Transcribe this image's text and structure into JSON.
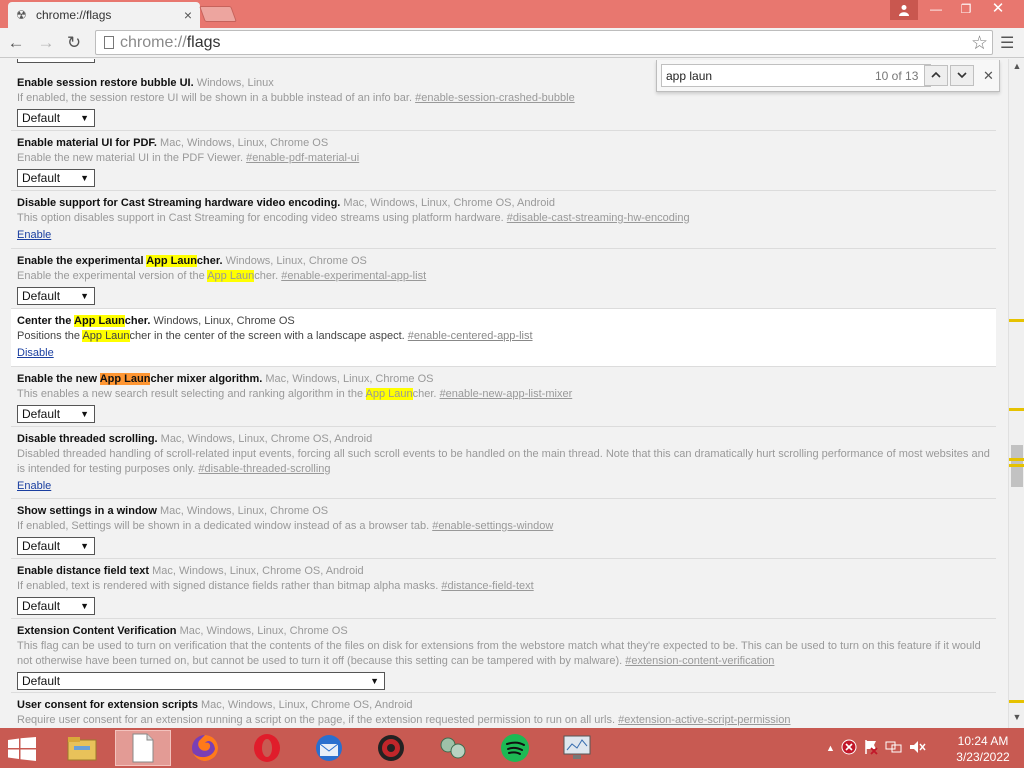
{
  "window": {
    "tab_title": "chrome://flags",
    "tab_close": "×",
    "user_icon": "person-icon",
    "min_label": "—",
    "max_label": "❐",
    "close_label": "✕"
  },
  "toolbar": {
    "url_scheme": "chrome://",
    "url_path": "flags"
  },
  "find": {
    "query": "app laun",
    "count": "10 of 13"
  },
  "flags": [
    {
      "title": "Enable session restore bubble UI.",
      "platforms": "Windows, Linux",
      "desc": "If enabled, the session restore UI will be shown in a bubble instead of an info bar.",
      "link": "#enable-session-crashed-bubble",
      "control": "Default"
    },
    {
      "title": "Enable material UI for PDF.",
      "platforms": "Mac, Windows, Linux, Chrome OS",
      "desc": "Enable the new material UI in the PDF Viewer.",
      "link": "#enable-pdf-material-ui",
      "control": "Default"
    },
    {
      "title": "Disable support for Cast Streaming hardware video encoding.",
      "platforms": "Mac, Windows, Linux, Chrome OS, Android",
      "desc": "This option disables support in Cast Streaming for encoding video streams using platform hardware.",
      "link": "#disable-cast-streaming-hw-encoding",
      "control": "Enable"
    },
    {
      "title_pre": "Enable the experimental ",
      "title_hl": "App Laun",
      "title_post": "cher.",
      "platforms": "Windows, Linux, Chrome OS",
      "desc_pre": "Enable the experimental version of the ",
      "desc_hl": "App Laun",
      "desc_post": "cher.",
      "link": "#enable-experimental-app-list",
      "control": "Default"
    },
    {
      "title_pre": "Center the ",
      "title_hl": "App Laun",
      "title_post": "cher.",
      "platforms": "Windows, Linux, Chrome OS",
      "desc_pre": "Positions the ",
      "desc_hl": "App Laun",
      "desc_post": "cher in the center of the screen with a landscape aspect.",
      "link": "#enable-centered-app-list",
      "control": "Disable"
    },
    {
      "title_pre": "Enable the new ",
      "title_hl": "App Laun",
      "title_post": "cher mixer algorithm.",
      "platforms": "Mac, Windows, Linux, Chrome OS",
      "desc_pre": "This enables a new search result selecting and ranking algorithm in the ",
      "desc_hl": "App Laun",
      "desc_post": "cher.",
      "link": "#enable-new-app-list-mixer",
      "control": "Default"
    },
    {
      "title": "Disable threaded scrolling.",
      "platforms": "Mac, Windows, Linux, Chrome OS, Android",
      "desc": "Disabled threaded handling of scroll-related input events, forcing all such scroll events to be handled on the main thread. Note that this can dramatically hurt scrolling performance of most websites and is intended for testing purposes only.",
      "link": "#disable-threaded-scrolling",
      "control": "Enable"
    },
    {
      "title": "Show settings in a window",
      "platforms": "Mac, Windows, Linux, Chrome OS",
      "desc": "If enabled, Settings will be shown in a dedicated window instead of as a browser tab.",
      "link": "#enable-settings-window",
      "control": "Default"
    },
    {
      "title": "Enable distance field text",
      "platforms": "Mac, Windows, Linux, Chrome OS, Android",
      "desc": "If enabled, text is rendered with signed distance fields rather than bitmap alpha masks.",
      "link": "#distance-field-text",
      "control": "Default"
    },
    {
      "title": "Extension Content Verification",
      "platforms": "Mac, Windows, Linux, Chrome OS",
      "desc": "This flag can be used to turn on verification that the contents of the files on disk for extensions from the webstore match what they're expected to be. This can be used to turn on this feature if it would not otherwise have been turned on, but cannot be used to turn it off (because this setting can be tampered with by malware).",
      "link": "#extension-content-verification",
      "control": "Default"
    },
    {
      "title": "User consent for extension scripts",
      "platforms": "Mac, Windows, Linux, Chrome OS, Android",
      "desc": "Require user consent for an extension running a script on the page, if the extension requested permission to run on all urls.",
      "link": "#extension-active-script-permission",
      "control": ""
    }
  ],
  "taskbar": {
    "apps": [
      "file-explorer-icon",
      "notepad-icon",
      "firefox-icon",
      "opera-icon",
      "thunderbird-icon",
      "game-app-icon",
      "network-app-icon",
      "spotify-icon",
      "monitor-app-icon"
    ],
    "time": "10:24 AM",
    "date": "3/23/2022"
  },
  "colors": {
    "titlebar": "#e8776f",
    "taskbar": "#c85a52",
    "highlight": "#ffff00",
    "active_highlight": "#ff9632",
    "link": "#1a3fa0"
  }
}
